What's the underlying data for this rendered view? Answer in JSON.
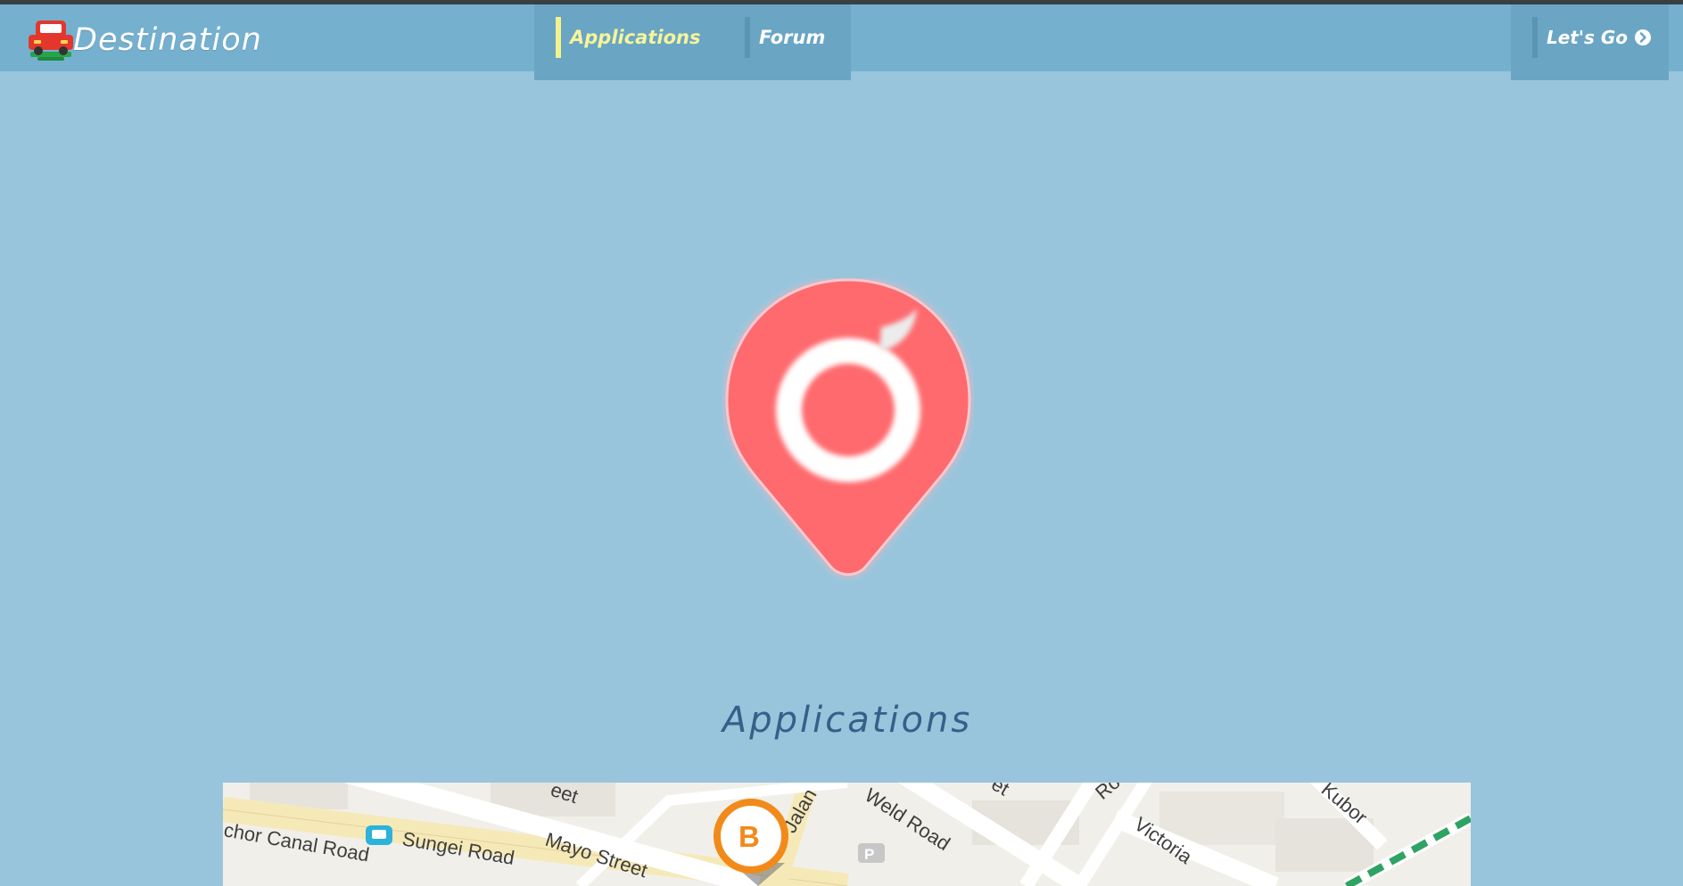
{
  "header": {
    "brand_name": "Destination",
    "logo_icon": "car-logo-icon",
    "nav": [
      {
        "label": "Applications",
        "active": true
      },
      {
        "label": "Forum",
        "active": false
      }
    ],
    "cta_label": "Let's Go",
    "cta_icon": "chevron-circle-right-icon"
  },
  "hero": {
    "icon": "map-pin-icon",
    "icon_color": "#fe6a6e"
  },
  "section": {
    "title": "Applications"
  },
  "map": {
    "labels": [
      "Sungei Road",
      "Mayo Street",
      "Jalan",
      "Weld Road",
      "Victoria",
      "Kubor",
      "chor Canal Road",
      "eet",
      "Ro",
      "et"
    ],
    "marker_label": "B",
    "parking_label": "P"
  },
  "colors": {
    "page_background": "#98c5dc",
    "navbar": "#75b0cf",
    "nav_highlight": "#f2f28e",
    "title": "#346089",
    "accent": "#fe6a6e"
  }
}
